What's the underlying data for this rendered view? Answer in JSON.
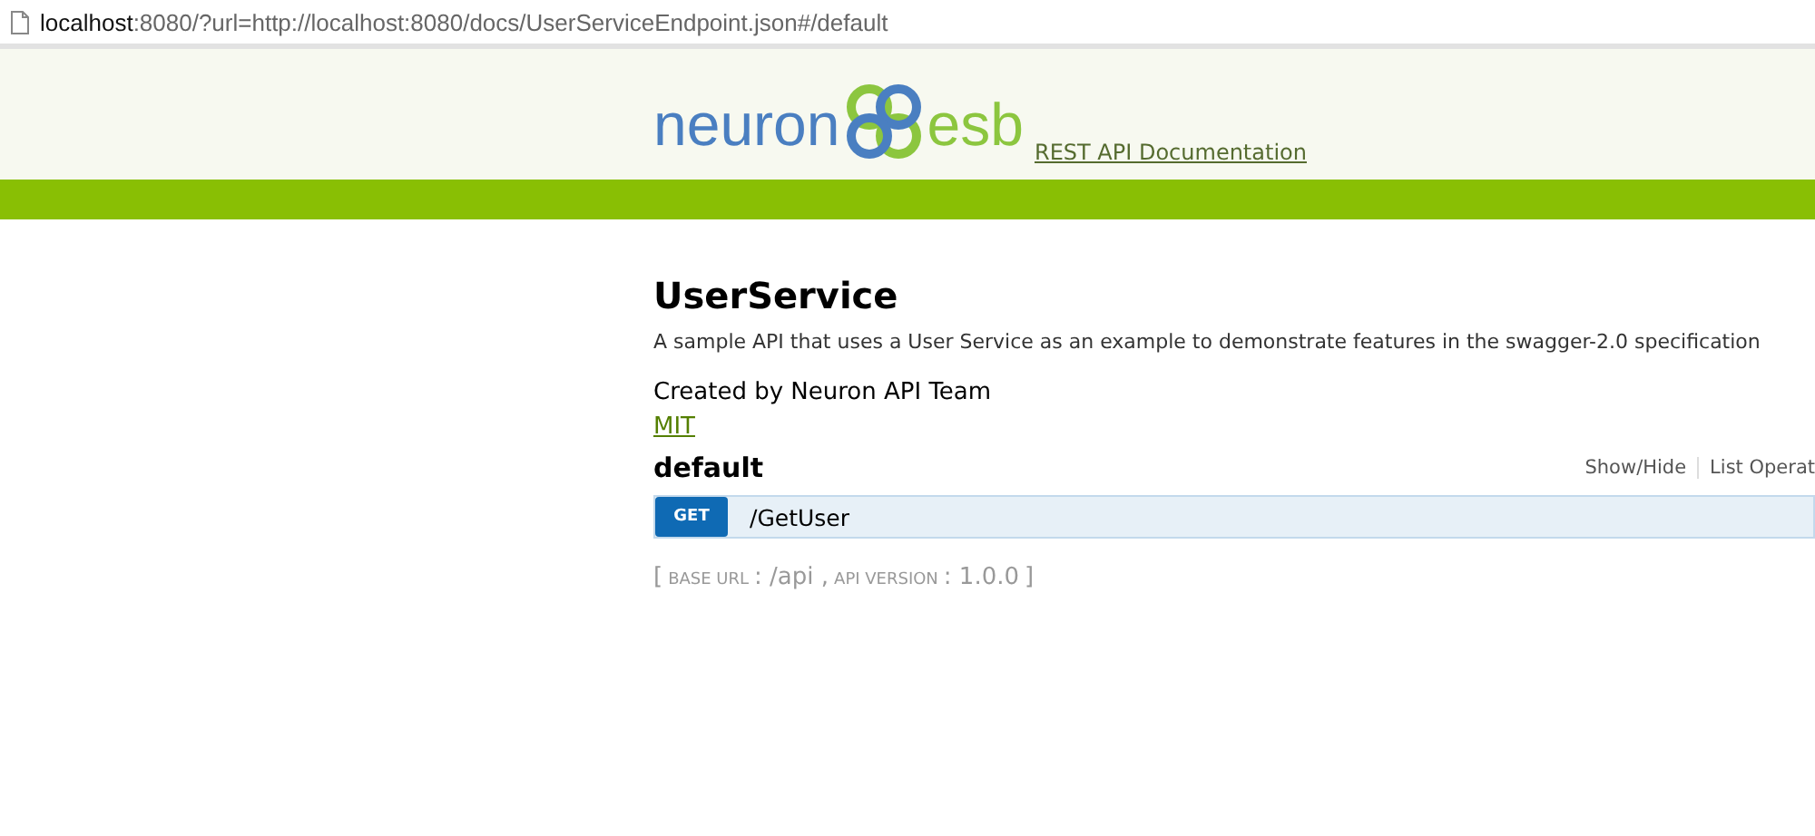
{
  "address_bar": {
    "host": "localhost",
    "rest": ":8080/?url=http://localhost:8080/docs/UserServiceEndpoint.json#/default"
  },
  "header": {
    "logo_left": "neuron",
    "logo_right": "esb",
    "link": "REST API Documentation"
  },
  "info": {
    "title": "UserService",
    "description": "A sample API that uses a User Service as an example to demonstrate features in the swagger-2.0 specification",
    "contact": "Created by Neuron API Team",
    "license": "MIT"
  },
  "resource": {
    "name": "default",
    "actions": [
      "Show/Hide",
      "List Operat"
    ],
    "operations": [
      {
        "method": "GET",
        "path": "/GetUser"
      }
    ]
  },
  "footer": {
    "open": "[",
    "base_url_label": "BASE URL",
    "base_url": ": /api ,",
    "version_label": "API VERSION",
    "version": ": 1.0.0",
    "close": "]"
  }
}
